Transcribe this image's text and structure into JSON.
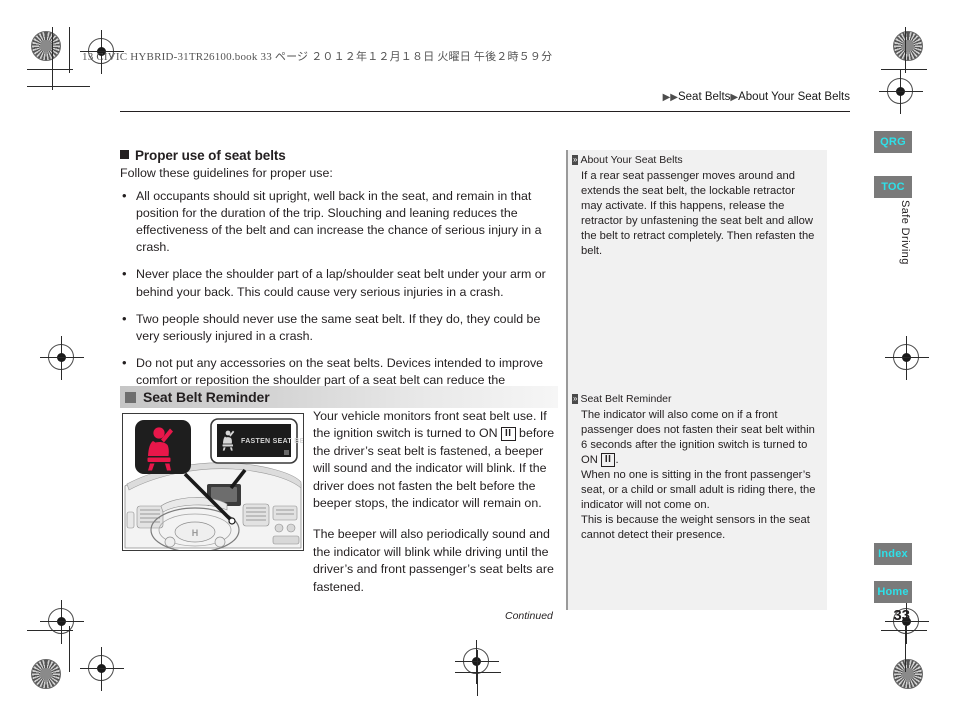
{
  "header": {
    "book_line": "13 CIVIC HYBRID-31TR26100.book   33 ページ   ２０１２年１２月１８日   火曜日   午後２時５９分",
    "breadcrumb_sep": "▶",
    "breadcrumb_items": [
      "Seat Belts",
      "About Your Seat Belts"
    ]
  },
  "left": {
    "subhead": "Proper use of seat belts",
    "lead": "Follow these guidelines for proper use:",
    "bullets": [
      "All occupants should sit upright, well back in the seat, and remain in that position for the duration of the trip. Slouching and leaning reduces the effectiveness of the belt and can increase the chance of serious injury in a crash.",
      "Never place the shoulder part of a lap/shoulder seat belt under your arm or behind your back. This could cause very serious injuries in a crash.",
      "Two people should never use the same seat belt. If they do, they could be very seriously injured in a crash.",
      "Do not put any accessories on the seat belts. Devices intended to improve comfort or reposition the shoulder part of a seat belt can reduce the protective capability and increase the chance of serious injury in a crash."
    ],
    "section_heading": "Seat Belt Reminder",
    "para1_a": "Your vehicle monitors front seat belt use. If the ignition switch is turned to ON",
    "ignition_symbol": "II",
    "para1_b": "before the driver’s seat belt is fastened, a beeper will sound and the indicator will blink. If the driver does not fasten the belt before the beeper stops, the indicator will remain on.",
    "para2": "The beeper will also periodically sound and the indicator will blink while driving until the driver’s and front passenger’s seat belts are fastened.",
    "continued": "Continued"
  },
  "figure": {
    "display_text": "FASTEN SEAT BELT",
    "telltale_color": "#e8174a"
  },
  "sidebar": {
    "note1": {
      "title": "About Your Seat Belts",
      "paragraphs": [
        "If a rear seat passenger moves around and extends the seat belt, the lockable retractor may activate. If this happens, release the retractor by unfastening the seat belt and allow the belt to retract completely. Then refasten the belt."
      ]
    },
    "note2": {
      "title": "Seat Belt Reminder",
      "para1_a": "The indicator will also come on if a front passenger does not fasten their seat belt within 6 seconds after the ignition switch is turned to ON",
      "ignition_symbol": "II",
      "para1_b": ".",
      "paragraphs": [
        "When no one is sitting in the front passenger’s seat, or a child or small adult is riding there, the indicator will not come on.",
        "This is because the weight sensors in the seat cannot detect their presence."
      ]
    }
  },
  "tabs": {
    "qrg": "QRG",
    "toc": "TOC",
    "section": "Safe Driving",
    "index": "Index",
    "home": "Home",
    "accent_color": "#2ee0e8"
  },
  "page_number": "33"
}
